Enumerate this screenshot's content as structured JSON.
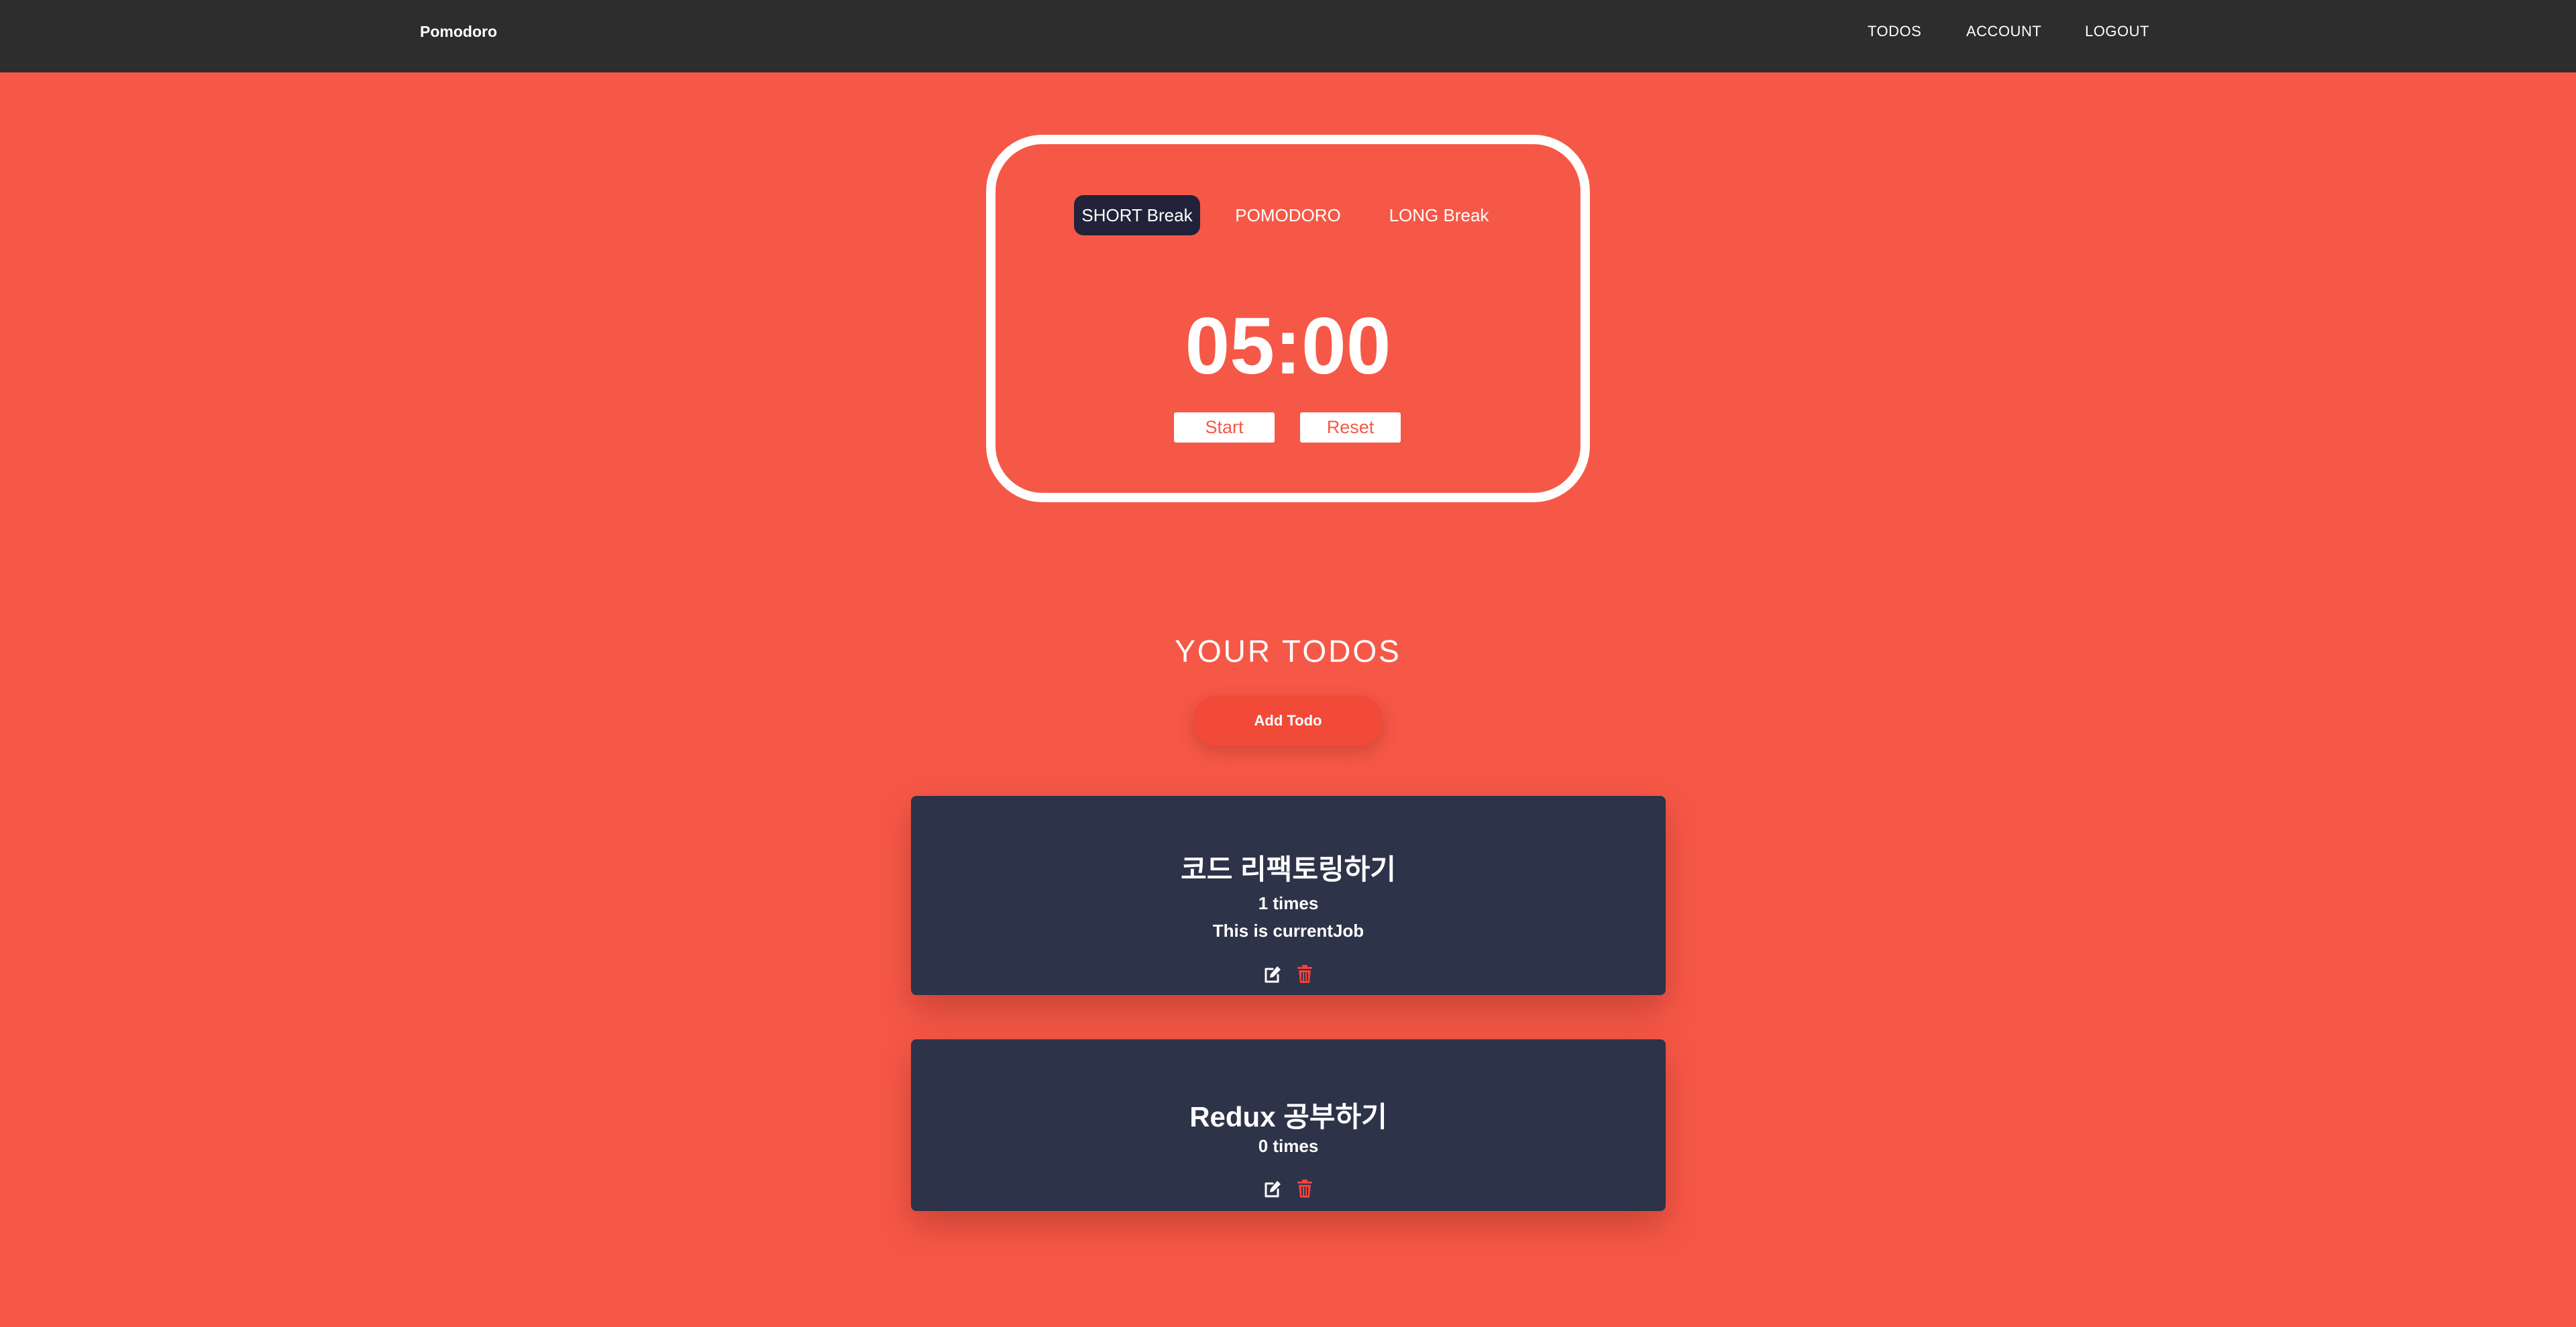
{
  "header": {
    "brand": "Pomodoro",
    "nav": {
      "todos": "TODOS",
      "account": "ACCOUNT",
      "logout": "LOGOUT"
    }
  },
  "timer": {
    "modes": {
      "short_break": "SHORT Break",
      "pomodoro": "POMODORO",
      "long_break": "LONG Break"
    },
    "active_mode": "short_break",
    "time": "05:00",
    "start_label": "Start",
    "reset_label": "Reset"
  },
  "todos": {
    "title": "YOUR TODOS",
    "add_label": "Add Todo",
    "items": [
      {
        "title": "코드 리팩토링하기",
        "count": "1 times",
        "status": "This is currentJob"
      },
      {
        "title": "Redux 공부하기",
        "count": "0 times"
      }
    ]
  },
  "icons": {
    "edit": "edit-icon",
    "delete": "trash-icon"
  },
  "colors": {
    "background": "#f65847",
    "navbar": "#2d2d2d",
    "active_mode": "#22233a",
    "card": "#2d3348",
    "delete_icon": "#f1423a"
  }
}
